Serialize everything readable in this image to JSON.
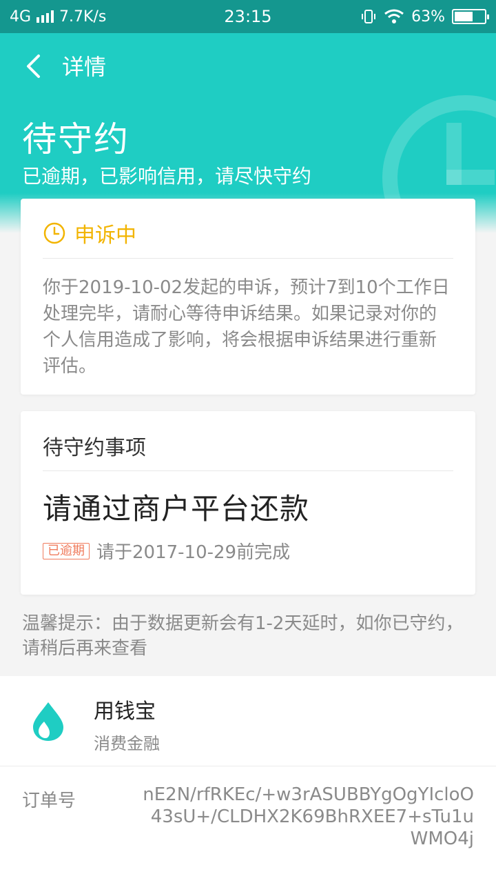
{
  "status_bar": {
    "network": "4G",
    "speed": "7.7K/s",
    "time": "23:15",
    "battery": "63%"
  },
  "header": {
    "back_icon": "chevron-left-icon",
    "title": "详情",
    "status_title": "待守约",
    "status_subtitle": "已逾期，已影响信用，请尽快守约"
  },
  "appeal": {
    "icon": "clock-icon",
    "title": "申诉中",
    "text": "你于2019-10-02发起的申诉，预计7到10个工作日处理完毕，请耐心等待申诉结果。如果记录对你的个人信用造成了影响，将会根据申诉结果进行重新评估。"
  },
  "task": {
    "heading": "待守约事项",
    "main": "请通过商户平台还款",
    "tag": "已逾期",
    "due": "请于2017-10-29前完成"
  },
  "tip": "温馨提示：由于数据更新会有1-2天延时，如你已守约，请稍后再来查看",
  "merchant": {
    "name": "用钱宝",
    "type": "消费金融",
    "logo_icon": "drop-logo-icon"
  },
  "order": {
    "label": "订单号",
    "value": "nE2N/rfRKEc/+w3rASUBBYgOgYIcloO43sU+/CLDHX2K69BhRXEE7+sTu1uWMO4j"
  },
  "colors": {
    "status_bar": "#14978f",
    "header": "#1fcdc3",
    "appeal_accent": "#f2b400",
    "overdue_tag": "#f07b5c"
  }
}
